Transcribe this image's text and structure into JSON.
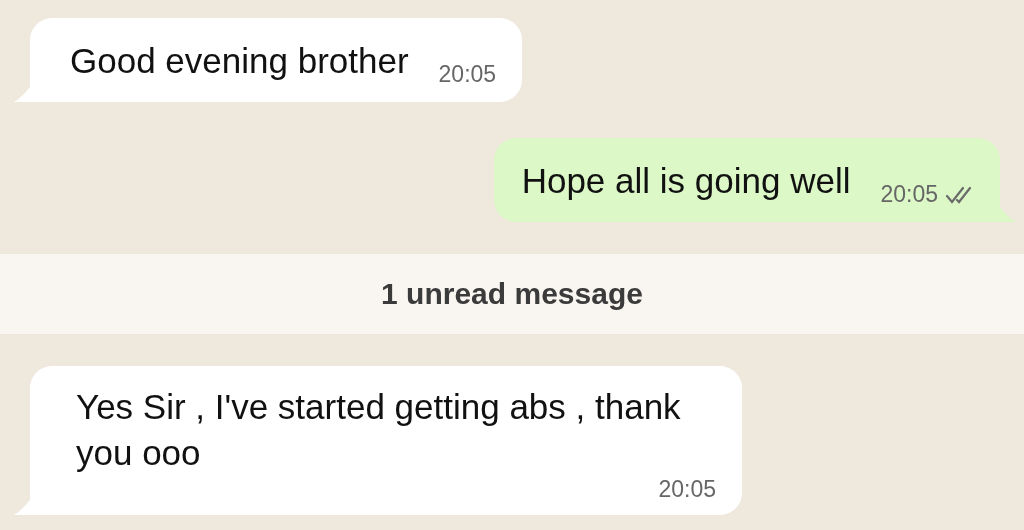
{
  "messages": [
    {
      "kind": "incoming",
      "text": "Good evening brother",
      "time": "20:05"
    },
    {
      "kind": "outgoing",
      "text": "Hope all is going well",
      "time": "20:05",
      "read": false
    },
    {
      "kind": "divider",
      "text": "1 unread message"
    },
    {
      "kind": "incoming",
      "text": "Yes Sir , I've started getting abs , thank you ooo",
      "time": "20:05"
    }
  ]
}
